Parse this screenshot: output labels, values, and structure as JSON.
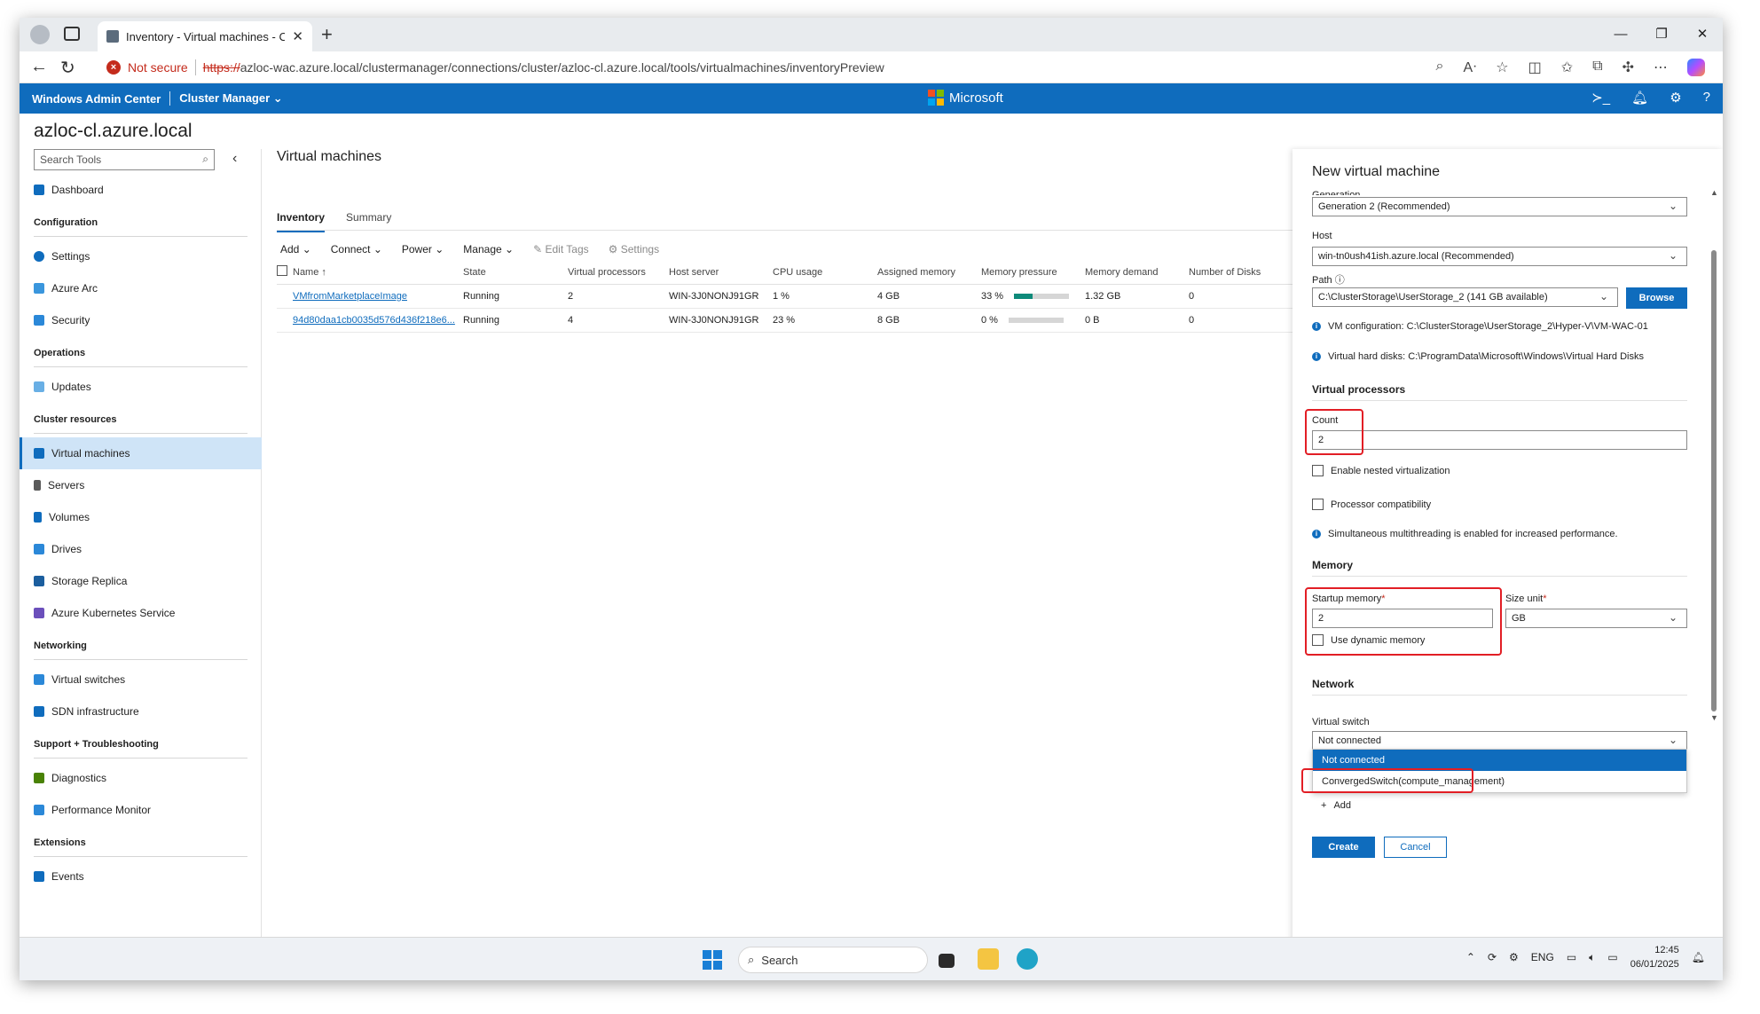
{
  "browser": {
    "tab_title": "Inventory - Virtual machines - Clu",
    "not_secure": "Not secure",
    "url_scheme": "https://",
    "url_rest": "azloc-wac.azure.local/clustermanager/connections/cluster/azloc-cl.azure.local/tools/virtualmachines/inventoryPreview"
  },
  "wac": {
    "brand": "Windows Admin Center",
    "context": "Cluster Manager",
    "microsoft": "Microsoft"
  },
  "cluster_title": "azloc-cl.azure.local",
  "sidebar": {
    "search_placeholder": "Search Tools",
    "dashboard": "Dashboard",
    "sections": {
      "configuration": "Configuration",
      "operations": "Operations",
      "cluster_resources": "Cluster resources",
      "networking": "Networking",
      "support": "Support + Troubleshooting",
      "extensions": "Extensions"
    },
    "items": {
      "settings": "Settings",
      "azure_arc": "Azure Arc",
      "security": "Security",
      "updates": "Updates",
      "virtual_machines": "Virtual machines",
      "servers": "Servers",
      "volumes": "Volumes",
      "drives": "Drives",
      "storage_replica": "Storage Replica",
      "aks": "Azure Kubernetes Service",
      "virtual_switches": "Virtual switches",
      "sdn": "SDN infrastructure",
      "diagnostics": "Diagnostics",
      "perfmon": "Performance Monitor",
      "events": "Events"
    }
  },
  "main": {
    "title": "Virtual machines",
    "tabs": [
      "Inventory",
      "Summary"
    ],
    "toolbar": {
      "add": "Add",
      "connect": "Connect",
      "power": "Power",
      "manage": "Manage",
      "edit_tags": "Edit Tags",
      "settings": "Settings"
    },
    "columns": [
      "Name",
      "State",
      "Virtual processors",
      "Host server",
      "CPU usage",
      "Assigned memory",
      "Memory pressure",
      "Memory demand",
      "Number of Disks"
    ],
    "rows": [
      {
        "name": "VMfromMarketplaceImage",
        "state": "Running",
        "vcpu": "2",
        "host": "WIN-3J0NONJ91GR",
        "cpu": "1 %",
        "assigned": "4 GB",
        "pressure": "33 %",
        "pressure_value": 0.33,
        "demand": "1.32 GB",
        "disks": "0"
      },
      {
        "name": "94d80daa1cb0035d576d436f218e6...",
        "state": "Running",
        "vcpu": "4",
        "host": "WIN-3J0NONJ91GR",
        "cpu": "23 %",
        "assigned": "8 GB",
        "pressure": "0 %",
        "pressure_value": 0.0,
        "demand": "0 B",
        "disks": "0"
      }
    ]
  },
  "panel": {
    "title": "New virtual machine",
    "generation_label": "Generation",
    "generation_value": "Generation 2 (Recommended)",
    "host_label": "Host",
    "host_value": "win-tn0ush41ish.azure.local (Recommended)",
    "path_label": "Path",
    "path_value": "C:\\ClusterStorage\\UserStorage_2 (141 GB available)",
    "browse": "Browse",
    "vm_config": "VM configuration: C:\\ClusterStorage\\UserStorage_2\\Hyper-V\\VM-WAC-01",
    "vhd": "Virtual hard disks: C:\\ProgramData\\Microsoft\\Windows\\Virtual Hard Disks",
    "vp_header": "Virtual processors",
    "count_label": "Count",
    "count_value": "2",
    "nested": "Enable nested virtualization",
    "proc_compat": "Processor compatibility",
    "smt_info": "Simultaneous multithreading is enabled for increased performance.",
    "memory_header": "Memory",
    "startup_label": "Startup memory",
    "startup_value": "2",
    "size_unit_label": "Size unit",
    "size_unit_value": "GB",
    "dynamic": "Use dynamic memory",
    "network_header": "Network",
    "vswitch_label": "Virtual switch",
    "vswitch_value": "Not connected",
    "vswitch_options": [
      "Not connected",
      "ConvergedSwitch(compute_management)"
    ],
    "add": "Add",
    "create": "Create",
    "cancel": "Cancel"
  },
  "taskbar": {
    "search": "Search",
    "lang": "ENG",
    "time": "12:45",
    "date": "06/01/2025"
  },
  "colors": {
    "accent": "#0f6cbd",
    "highlight": "#e21e25",
    "pressure_bar": "#0e8a7a"
  }
}
